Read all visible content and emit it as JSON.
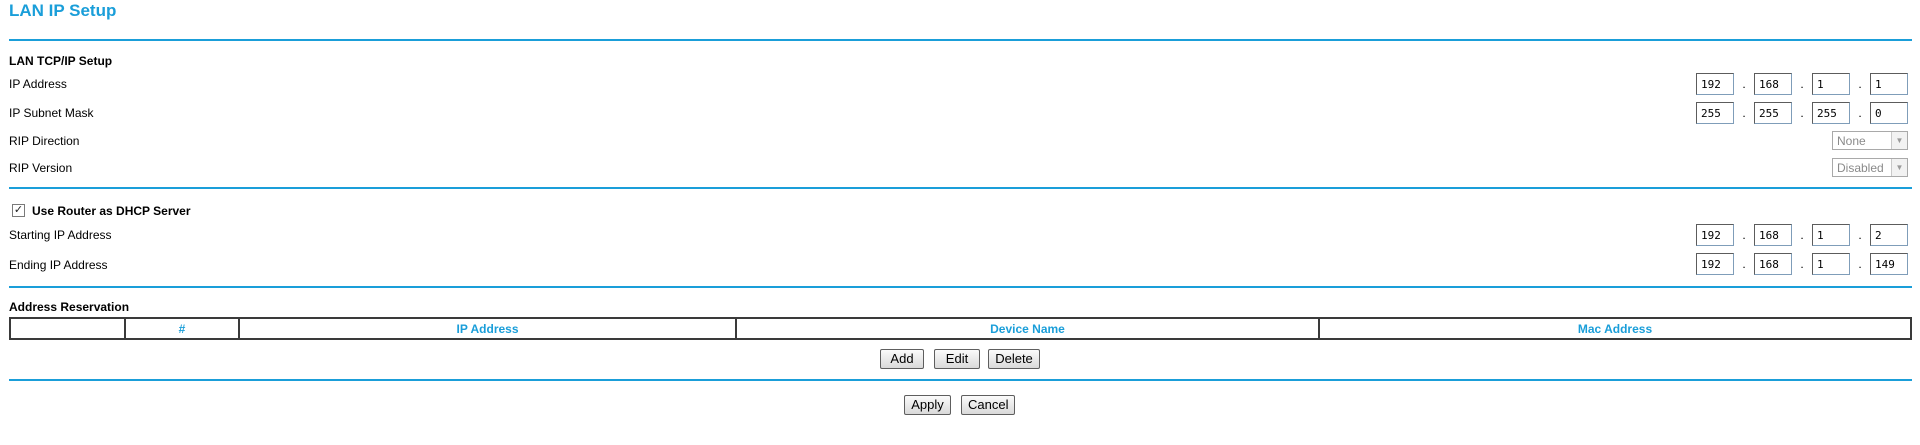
{
  "page": {
    "title": "LAN IP Setup"
  },
  "lan": {
    "section_title": "LAN TCP/IP Setup",
    "ip_address": {
      "label": "IP Address",
      "octets": [
        "192",
        "168",
        "1",
        "1"
      ]
    },
    "subnet_mask": {
      "label": "IP Subnet Mask",
      "octets": [
        "255",
        "255",
        "255",
        "0"
      ]
    },
    "rip_direction": {
      "label": "RIP Direction",
      "value": "None"
    },
    "rip_version": {
      "label": "RIP Version",
      "value": "Disabled"
    }
  },
  "dhcp": {
    "checkbox_label": "Use Router as DHCP Server",
    "checked": true,
    "check_mark": "✓",
    "starting_ip": {
      "label": "Starting IP Address",
      "octets": [
        "192",
        "168",
        "1",
        "2"
      ]
    },
    "ending_ip": {
      "label": "Ending IP Address",
      "octets": [
        "192",
        "168",
        "1",
        "149"
      ]
    }
  },
  "reservation": {
    "section_title": "Address Reservation",
    "columns": [
      "",
      "#",
      "IP Address",
      "Device Name",
      "Mac Address"
    ],
    "buttons": {
      "add": "Add",
      "edit": "Edit",
      "delete": "Delete"
    }
  },
  "footer": {
    "apply": "Apply",
    "cancel": "Cancel"
  },
  "colors": {
    "accent": "#1a9ed9"
  },
  "icons": {
    "dropdown": "chevron-down-icon",
    "checkbox": "checkmark-icon"
  }
}
